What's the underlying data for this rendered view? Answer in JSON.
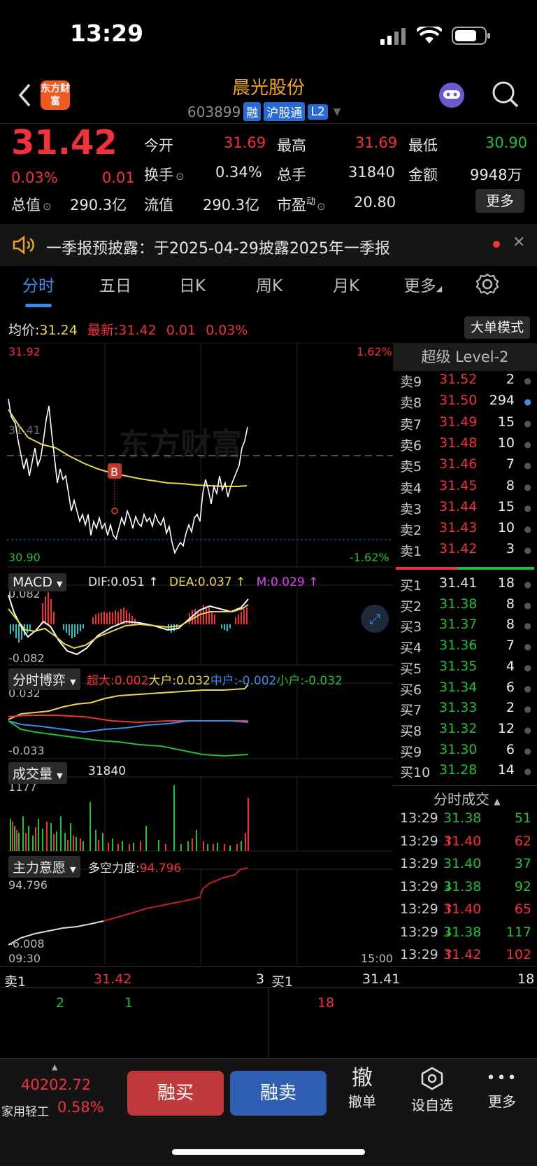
{
  "status_bar": {
    "time": "13:29"
  },
  "header": {
    "logo_text": "东方财富",
    "stock_name": "晨光股份",
    "stock_code": "603899",
    "tags": [
      "融",
      "沪股通",
      "L2"
    ]
  },
  "quote": {
    "price": "31.42",
    "change_pct": "0.03%",
    "change": "0.01",
    "open_label": "今开",
    "open": "31.69",
    "high_label": "最高",
    "high": "31.69",
    "low_label": "最低",
    "low": "30.90",
    "turnover_label": "换手",
    "turnover": "0.34%",
    "volume_label": "总手",
    "volume": "31840",
    "amount_label": "金额",
    "amount": "9948万",
    "mktcap_label": "总值",
    "mktcap": "290.3亿",
    "float_label": "流值",
    "float": "290.3亿",
    "pe_label": "市盈",
    "pe_sup": "动",
    "pe": "20.80",
    "more_button": "更多"
  },
  "notice": {
    "text": "一季报预披露：于2025-04-29披露2025年一季报"
  },
  "tabs": [
    "分时",
    "五日",
    "日K",
    "周K",
    "月K",
    "更多"
  ],
  "intraday": {
    "avg_label": "均价:",
    "avg": "31.24",
    "latest_label": "最新:",
    "latest": "31.42",
    "chg": "0.01",
    "chg_pct": "0.03%",
    "mode_button": "大单模式",
    "y_top": "31.92",
    "y_bottom": "30.90",
    "y_mid": "31.41",
    "pct_top": "1.62%",
    "pct_bottom": "-1.62%",
    "marker": "B",
    "watermark": "东方财富",
    "time_start": "09:30",
    "time_end": "15:00"
  },
  "macd": {
    "label": "MACD",
    "dif": "DIF:0.051 ↑",
    "dea": "DEA:0.037 ↑",
    "m": "M:0.029 ↑",
    "top": "0.082",
    "bottom": "-0.082"
  },
  "game": {
    "label": "分时博弈",
    "super": "超大:0.002",
    "large": "大户:0.032",
    "mid": "中户:-0.002",
    "small": "小户:-0.032",
    "top": "0.032",
    "bottom": "-0.033"
  },
  "volume": {
    "label": "成交量",
    "value": "31840",
    "top": "1177"
  },
  "main_force": {
    "label": "主力意愿",
    "power_label": "多空力度:",
    "power": "94.796",
    "top": "94.796",
    "bottom": "-6.008"
  },
  "orderbook": {
    "title": "超级 Level-2",
    "asks": [
      {
        "label": "卖9",
        "price": "31.52",
        "vol": "2"
      },
      {
        "label": "卖8",
        "price": "31.50",
        "vol": "294"
      },
      {
        "label": "卖7",
        "price": "31.49",
        "vol": "15"
      },
      {
        "label": "卖6",
        "price": "31.48",
        "vol": "10"
      },
      {
        "label": "卖5",
        "price": "31.46",
        "vol": "7"
      },
      {
        "label": "卖4",
        "price": "31.45",
        "vol": "8"
      },
      {
        "label": "卖3",
        "price": "31.44",
        "vol": "15"
      },
      {
        "label": "卖2",
        "price": "31.43",
        "vol": "10"
      },
      {
        "label": "卖1",
        "price": "31.42",
        "vol": "3"
      }
    ],
    "bids": [
      {
        "label": "买1",
        "price": "31.41",
        "vol": "18"
      },
      {
        "label": "买2",
        "price": "31.38",
        "vol": "8"
      },
      {
        "label": "买3",
        "price": "31.37",
        "vol": "8"
      },
      {
        "label": "买4",
        "price": "31.36",
        "vol": "7"
      },
      {
        "label": "买5",
        "price": "31.35",
        "vol": "4"
      },
      {
        "label": "买6",
        "price": "31.34",
        "vol": "6"
      },
      {
        "label": "买7",
        "price": "31.33",
        "vol": "2"
      },
      {
        "label": "买8",
        "price": "31.32",
        "vol": "12"
      },
      {
        "label": "买9",
        "price": "31.30",
        "vol": "6"
      },
      {
        "label": "买10",
        "price": "31.28",
        "vol": "14"
      }
    ]
  },
  "trades": {
    "title": "分时成交",
    "rows": [
      {
        "time": "13:29",
        "price": "31.38",
        "vol": "51",
        "dir": ""
      },
      {
        "time": "13:29",
        "price": "31.40",
        "vol": "62",
        "dir": "↑"
      },
      {
        "time": "13:29",
        "price": "31.40",
        "vol": "37",
        "dir": ""
      },
      {
        "time": "13:29",
        "price": "31.38",
        "vol": "92",
        "dir": "↓"
      },
      {
        "time": "13:29",
        "price": "31.40",
        "vol": "65",
        "dir": "↑"
      },
      {
        "time": "13:29",
        "price": "31.38",
        "vol": "117",
        "dir": "↓"
      },
      {
        "time": "13:29",
        "price": "31.42",
        "vol": "102",
        "dir": "↑"
      }
    ]
  },
  "queue": {
    "sell_label": "卖1",
    "sell_price": "31.42",
    "sell_vol": "3",
    "buy_label": "买1",
    "buy_price": "31.41",
    "buy_vol": "18",
    "sell_items": [
      "2",
      "1"
    ],
    "buy_items": [
      "18"
    ]
  },
  "bottom_bar": {
    "index_value": "40202.72",
    "index_name": "家用轻工",
    "index_pct": "0.58%",
    "buy_button": "融买",
    "sell_button": "融卖",
    "cancel_glyph": "撤",
    "cancel_label": "撤单",
    "watch_label": "设自选",
    "more_label": "更多"
  },
  "colors": {
    "up": "#f2313b",
    "down": "#1fbf3a",
    "avg_line": "#e8d84a",
    "accent": "#3d8be8"
  }
}
